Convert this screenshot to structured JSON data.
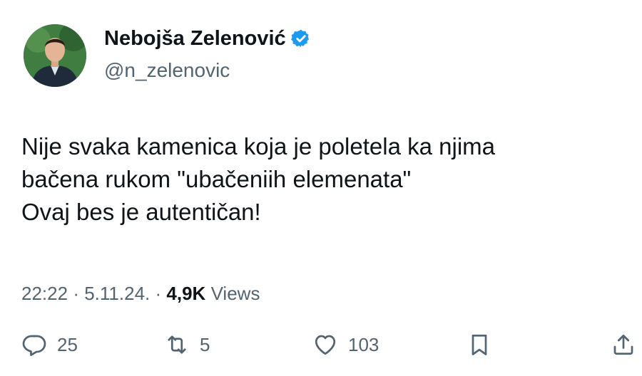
{
  "author": {
    "display_name": "Nebojša Zelenović",
    "handle": "@n_zelenovic",
    "verified_color": "#1d9bf0"
  },
  "tweet": {
    "text_lines": [
      "Nije svaka kamenica koja je poletela ka njima",
      "bačena rukom \"ubačeniih elemenata\"",
      "Ovaj bes je autentičan!"
    ]
  },
  "meta": {
    "time": "22:22",
    "separator": "·",
    "date": "5.11.24.",
    "views_count": "4,9K",
    "views_label": "Views"
  },
  "actions": {
    "reply": {
      "icon": "reply-icon",
      "count": "25"
    },
    "retweet": {
      "icon": "retweet-icon",
      "count": "5"
    },
    "like": {
      "icon": "heart-icon",
      "count": "103"
    },
    "bookmark": {
      "icon": "bookmark-icon"
    },
    "share": {
      "icon": "share-icon"
    }
  },
  "colors": {
    "text_primary": "#0f1419",
    "text_secondary": "#536471",
    "avatar_background": "#2f6b35"
  }
}
